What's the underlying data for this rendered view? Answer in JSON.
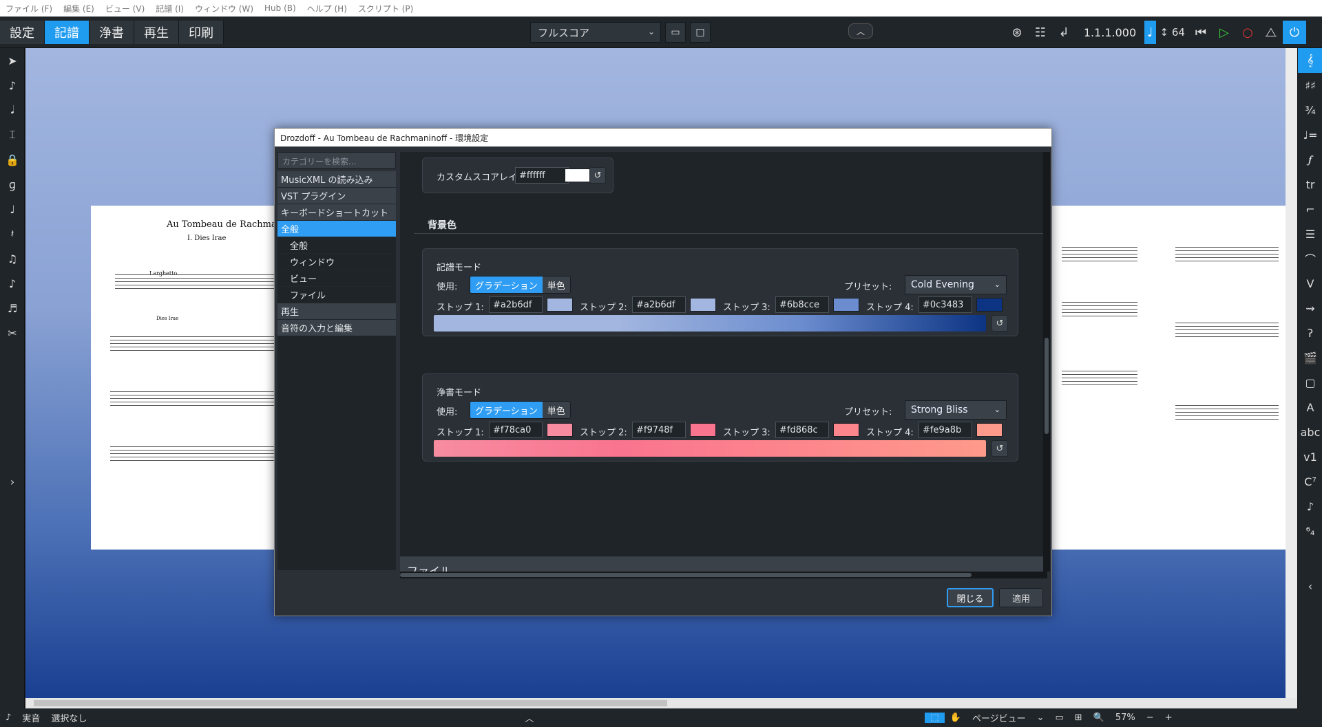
{
  "menubar": [
    "ファイル (F)",
    "編集 (E)",
    "ビュー (V)",
    "記譜 (I)",
    "ウィンドウ (W)",
    "Hub (B)",
    "ヘルプ (H)",
    "スクリプト (P)"
  ],
  "modes": [
    "設定",
    "記譜",
    "浄書",
    "再生",
    "印刷"
  ],
  "layout_select": "フルスコア",
  "transport": {
    "position": "1.1.1.000",
    "tempo": "64"
  },
  "score": {
    "title": "Au Tombeau de Rachmanino",
    "movement": "I. Dies Irae",
    "tempo_mark": "Larghetto",
    "section_label": "Dies Irae"
  },
  "dialog": {
    "title": "Drozdoff - Au Tombeau de Rachmaninoff - 環境設定",
    "search_placeholder": "カテゴリーを検索...",
    "categories": [
      {
        "label": "MusicXML の読み込み"
      },
      {
        "label": "VST プラグイン"
      },
      {
        "label": "キーボードショートカット"
      },
      {
        "label": "全般"
      },
      {
        "label": "全般"
      },
      {
        "label": "ウィンドウ"
      },
      {
        "label": "ビュー"
      },
      {
        "label": "ファイル"
      },
      {
        "label": "再生"
      },
      {
        "label": "音符の入力と編集"
      }
    ],
    "custom_layout": {
      "label": "カスタムスコアレイアウト:",
      "hex": "#ffffff",
      "color": "#ffffff"
    },
    "bg_section": "背景色",
    "write_mode": {
      "title": "記譜モード",
      "use_label": "使用:",
      "seg_gradient": "グラデーション",
      "seg_single": "単色",
      "preset_label": "プリセット:",
      "preset": "Cold Evening",
      "stops": [
        {
          "label": "ストップ 1:",
          "hex": "#a2b6df",
          "color": "#a2b6df"
        },
        {
          "label": "ストップ 2:",
          "hex": "#a2b6df",
          "color": "#a2b6df"
        },
        {
          "label": "ストップ 3:",
          "hex": "#6b8cce",
          "color": "#6b8cce"
        },
        {
          "label": "ストップ 4:",
          "hex": "#0c3483",
          "color": "#0c3483"
        }
      ]
    },
    "engrave_mode": {
      "title": "浄書モード",
      "use_label": "使用:",
      "seg_gradient": "グラデーション",
      "seg_single": "単色",
      "preset_label": "プリセット:",
      "preset": "Strong Bliss",
      "stops": [
        {
          "label": "ストップ 1:",
          "hex": "#f78ca0",
          "color": "#f78ca0"
        },
        {
          "label": "ストップ 2:",
          "hex": "#f9748f",
          "color": "#f9748f"
        },
        {
          "label": "ストップ 3:",
          "hex": "#fd868c",
          "color": "#fd868c"
        },
        {
          "label": "ストップ 4:",
          "hex": "#fe9a8b",
          "color": "#fe9a8b"
        }
      ]
    },
    "file_section": "ファイル",
    "close_button": "閉じる",
    "apply_button": "適用"
  },
  "status": {
    "mode": "実音",
    "selection": "選択なし",
    "view": "ページビュー",
    "zoom": "57%"
  }
}
